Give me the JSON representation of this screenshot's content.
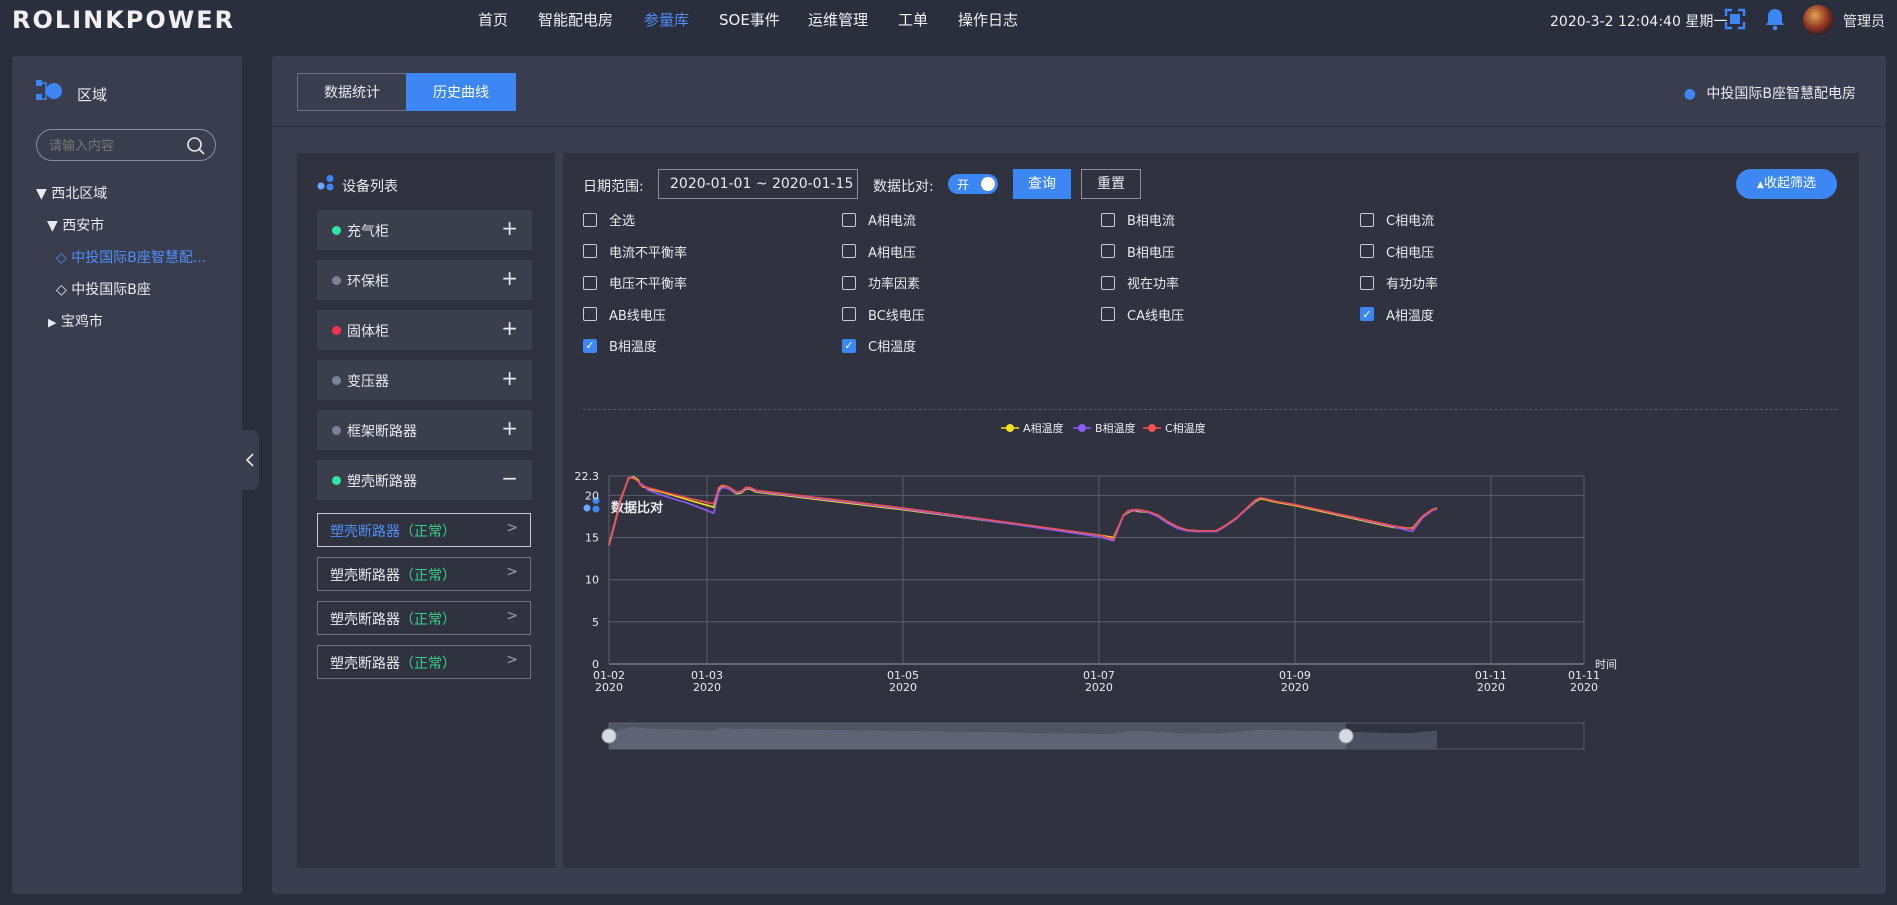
{
  "header": {
    "logo": "ROLINKPOWER",
    "nav": [
      {
        "label": "首页",
        "active": false
      },
      {
        "label": "智能配电房",
        "active": false
      },
      {
        "label": "参量库",
        "active": true
      },
      {
        "label": "SOE事件",
        "active": false
      },
      {
        "label": "运维管理",
        "active": false
      },
      {
        "label": "工单",
        "active": false
      },
      {
        "label": "操作日志",
        "active": false
      }
    ],
    "datetime": "2020-3-2 12:04:40 星期一",
    "user": "管理员"
  },
  "sidebar": {
    "title": "区域",
    "search_placeholder": "请输入内容",
    "tree": [
      {
        "label": "西北区域",
        "level": 0,
        "expanded": true
      },
      {
        "label": "西安市",
        "level": 1,
        "expanded": true
      },
      {
        "label": "中投国际B座智慧配...",
        "level": 2,
        "selected": true
      },
      {
        "label": "中投国际B座",
        "level": 2,
        "selected": false
      },
      {
        "label": "宝鸡市",
        "level": 1,
        "expanded": false
      }
    ]
  },
  "tabs": [
    {
      "label": "数据统计",
      "active": false
    },
    {
      "label": "历史曲线",
      "active": true
    }
  ],
  "room_name": "中投国际B座智慧配电房",
  "device_list": {
    "title": "设备列表",
    "devices": [
      {
        "label": "充气柜",
        "color": "#2ee6a0",
        "expanded": false
      },
      {
        "label": "环保柜",
        "color": "#7a8299",
        "expanded": false
      },
      {
        "label": "固体柜",
        "color": "#f5334a",
        "expanded": false
      },
      {
        "label": "变压器",
        "color": "#7a8299",
        "expanded": false
      },
      {
        "label": "框架断路器",
        "color": "#7a8299",
        "expanded": false
      },
      {
        "label": "塑壳断路器",
        "color": "#2ee6a0",
        "expanded": true
      }
    ],
    "sub_items": [
      {
        "name": "塑壳断路器",
        "status": "（正常）",
        "selected": true
      },
      {
        "name": "塑壳断路器",
        "status": "（正常）",
        "selected": false
      },
      {
        "name": "塑壳断路器",
        "status": "（正常）",
        "selected": false
      },
      {
        "name": "塑壳断路器",
        "status": "（正常）",
        "selected": false
      }
    ]
  },
  "filters": {
    "date_label": "日期范围:",
    "date_value": "2020-01-01 ~ 2020-01-15",
    "compare_label": "数据比对:",
    "toggle_label": "开",
    "query_button": "查询",
    "reset_button": "重置",
    "collapse_button": "收起筛选",
    "checkboxes": [
      {
        "label": "全选",
        "checked": false
      },
      {
        "label": "A相电流",
        "checked": false
      },
      {
        "label": "B相电流",
        "checked": false
      },
      {
        "label": "C相电流",
        "checked": false
      },
      {
        "label": "电流不平衡率",
        "checked": false
      },
      {
        "label": "A相电压",
        "checked": false
      },
      {
        "label": "B相电压",
        "checked": false
      },
      {
        "label": "C相电压",
        "checked": false
      },
      {
        "label": "电压不平衡率",
        "checked": false
      },
      {
        "label": "功率因素",
        "checked": false
      },
      {
        "label": "视在功率",
        "checked": false
      },
      {
        "label": "有功功率",
        "checked": false
      },
      {
        "label": "AB线电压",
        "checked": false
      },
      {
        "label": "BC线电压",
        "checked": false
      },
      {
        "label": "CA线电压",
        "checked": false
      },
      {
        "label": "A相温度",
        "checked": true
      },
      {
        "label": "B相温度",
        "checked": true
      },
      {
        "label": "C相温度",
        "checked": true
      }
    ]
  },
  "chart_section_title": "数据比对",
  "chart_data": {
    "type": "line",
    "xlabel": "时间",
    "ylabel": "",
    "ylim": [
      0,
      22.3
    ],
    "yticks": [
      "0",
      "5",
      "10",
      "15",
      "20",
      "22.3"
    ],
    "xticks": [
      {
        "date": "01-02",
        "year": "2020",
        "day": 0
      },
      {
        "date": "01-03",
        "year": "2020",
        "day": 1
      },
      {
        "date": "01-05",
        "year": "2020",
        "day": 3
      },
      {
        "date": "01-07",
        "year": "2020",
        "day": 5
      },
      {
        "date": "01-09",
        "year": "2020",
        "day": 7
      },
      {
        "date": "01-11",
        "year": "2020",
        "day": 9
      },
      {
        "date": "01-11",
        "year": "2020",
        "day": 9.95
      }
    ],
    "grid": true,
    "legend_position": "top-center",
    "series": [
      {
        "name": "A相温度",
        "color": "#f0e020",
        "x": [
          0,
          0.06,
          0.12,
          0.2,
          0.25,
          0.3,
          0.32,
          0.35,
          0.4,
          0.6,
          0.8,
          1.07,
          1.12,
          1.15,
          1.2,
          1.25,
          1.3,
          1.35,
          1.4,
          1.45,
          1.5,
          2.0,
          3.0,
          4.0,
          5.0,
          5.15,
          5.2,
          5.25,
          5.3,
          5.35,
          5.4,
          5.5,
          5.6,
          5.7,
          5.8,
          5.9,
          6.0,
          6.1,
          6.2,
          6.3,
          6.4,
          6.6,
          6.65,
          6.7,
          6.8,
          7.0,
          8.0,
          8.2,
          8.3,
          8.4,
          8.45
        ],
        "y": [
          14.2,
          16.8,
          19.6,
          22.0,
          22.2,
          21.8,
          21.3,
          21.0,
          20.8,
          20.2,
          19.5,
          18.6,
          20.6,
          21.0,
          20.9,
          20.6,
          20.2,
          20.3,
          20.8,
          20.7,
          20.4,
          19.7,
          18.3,
          16.8,
          15.3,
          15.0,
          16.3,
          17.6,
          18.0,
          18.2,
          18.1,
          18.0,
          17.6,
          16.8,
          16.2,
          15.9,
          15.8,
          15.8,
          15.8,
          16.5,
          17.3,
          19.3,
          19.6,
          19.5,
          19.2,
          18.8,
          16.2,
          16.1,
          17.5,
          18.3,
          18.5
        ]
      },
      {
        "name": "B相温度",
        "color": "#8a5cf5",
        "x": [
          0,
          0.06,
          0.12,
          0.2,
          0.25,
          0.3,
          0.32,
          0.35,
          0.4,
          0.6,
          0.8,
          1.07,
          1.12,
          1.15,
          1.2,
          1.25,
          1.3,
          1.35,
          1.4,
          1.45,
          1.5,
          2.0,
          3.0,
          4.0,
          5.0,
          5.15,
          5.2,
          5.25,
          5.3,
          5.35,
          5.4,
          5.5,
          5.6,
          5.7,
          5.8,
          5.9,
          6.0,
          6.1,
          6.2,
          6.3,
          6.4,
          6.6,
          6.65,
          6.7,
          6.8,
          7.0,
          8.0,
          8.2,
          8.3,
          8.4,
          8.45
        ],
        "y": [
          14.0,
          16.6,
          19.4,
          22.1,
          22.1,
          21.6,
          21.4,
          21.2,
          20.6,
          19.8,
          19.1,
          17.9,
          20.4,
          20.9,
          20.9,
          20.6,
          20.3,
          20.4,
          20.9,
          20.8,
          20.5,
          19.8,
          18.4,
          16.8,
          15.1,
          14.6,
          16.1,
          17.6,
          18.1,
          18.2,
          18.2,
          18.0,
          17.5,
          16.7,
          16.1,
          15.8,
          15.7,
          15.7,
          15.7,
          16.4,
          17.2,
          19.4,
          19.7,
          19.6,
          19.3,
          18.9,
          16.3,
          15.7,
          17.3,
          18.2,
          18.4
        ]
      },
      {
        "name": "C相温度",
        "color": "#f55050",
        "x": [
          0,
          0.06,
          0.12,
          0.2,
          0.25,
          0.3,
          0.32,
          0.35,
          0.4,
          0.6,
          0.8,
          1.07,
          1.12,
          1.15,
          1.2,
          1.25,
          1.3,
          1.35,
          1.4,
          1.45,
          1.5,
          2.0,
          3.0,
          4.0,
          5.0,
          5.15,
          5.2,
          5.25,
          5.3,
          5.35,
          5.4,
          5.5,
          5.6,
          5.7,
          5.8,
          5.9,
          6.0,
          6.1,
          6.2,
          6.3,
          6.4,
          6.6,
          6.65,
          6.7,
          6.8,
          7.0,
          8.0,
          8.2,
          8.3,
          8.4,
          8.45
        ],
        "y": [
          14.1,
          16.7,
          19.5,
          22.1,
          22.0,
          21.7,
          21.2,
          21.1,
          20.9,
          20.3,
          19.7,
          19.0,
          20.9,
          21.2,
          21.1,
          20.8,
          20.4,
          20.5,
          21.0,
          20.9,
          20.6,
          19.9,
          18.5,
          16.9,
          15.3,
          14.8,
          16.3,
          17.7,
          18.2,
          18.3,
          18.3,
          18.1,
          17.7,
          16.9,
          16.3,
          15.9,
          15.8,
          15.8,
          15.8,
          16.5,
          17.3,
          19.5,
          19.7,
          19.6,
          19.3,
          18.9,
          16.4,
          16.0,
          17.5,
          18.3,
          18.5
        ]
      }
    ]
  }
}
